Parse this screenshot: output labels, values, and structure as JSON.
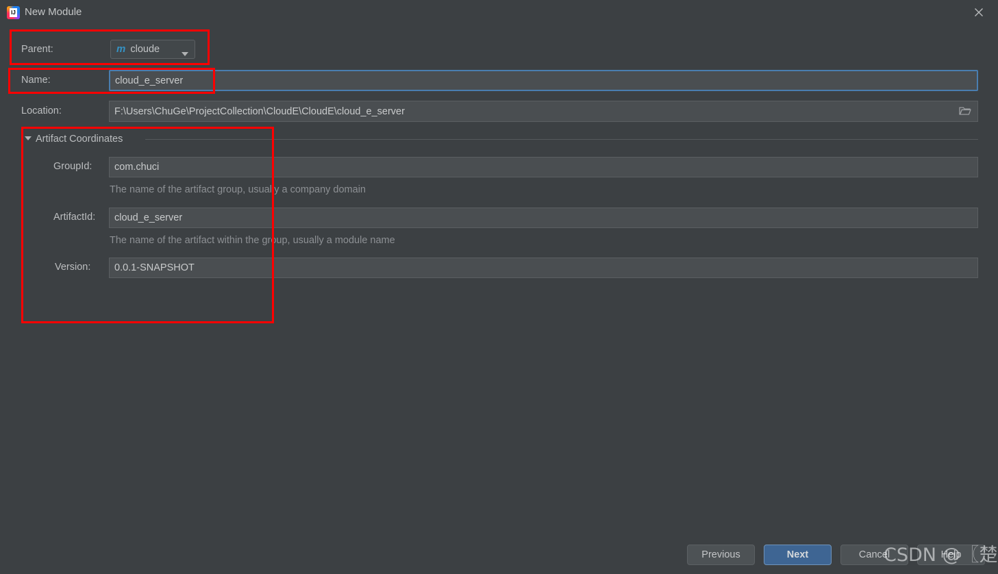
{
  "window": {
    "title": "New Module",
    "app_icon": "intellij-idea-icon",
    "close_icon": "close-icon"
  },
  "form": {
    "parent": {
      "label": "Parent:",
      "value": "cloude",
      "icon": "maven-module-icon",
      "arrow_icon": "chevron-down-icon"
    },
    "name": {
      "label": "Name:",
      "value": "cloud_e_server",
      "placeholder": ""
    },
    "location": {
      "label": "Location:",
      "value": "F:\\Users\\ChuGe\\ProjectCollection\\CloudE\\CloudE\\cloud_e_server",
      "placeholder": "",
      "browse_icon": "folder-icon"
    }
  },
  "artifact_coordinates": {
    "title": "Artifact Coordinates",
    "expanded": true,
    "toggle_icon": "triangle-down-icon",
    "group_id": {
      "label": "GroupId:",
      "value": "com.chuci",
      "hint": "The name of the artifact group, usually a company domain"
    },
    "artifact_id": {
      "label": "ArtifactId:",
      "value": "cloud_e_server",
      "hint": "The name of the artifact within the group, usually a module name"
    },
    "version": {
      "label": "Version:",
      "value": "0.0.1-SNAPSHOT"
    }
  },
  "footer": {
    "previous_label": "Previous",
    "next_label": "Next",
    "cancel_label": "Cancel",
    "help_label": "Help"
  },
  "watermark": {
    "text": "CSDN @〖楚辞〗"
  },
  "colors": {
    "background": "#3c4043",
    "input_fill": "#4a4e51",
    "accent_blue": "#3e6593",
    "focus_border": "#4a7eb0",
    "annotation_red": "#ff0000",
    "maven_icon_blue": "#3592c4"
  }
}
